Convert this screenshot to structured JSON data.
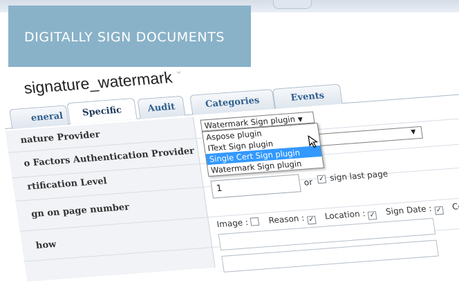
{
  "banner": {
    "title": "DIGITALLY SIGN DOCUMENTS"
  },
  "header": {
    "object_name": "signature_watermark"
  },
  "tabs": {
    "row1": [
      "eneral",
      "Specific",
      "Audit"
    ],
    "row2": [
      "Categories",
      "Events"
    ],
    "active": "Specific"
  },
  "fields": {
    "provider_label": "nature Provider",
    "two_factor_label": "o Factors Authentication Provider",
    "cert_level_label": "rtification Level",
    "page_number_label": "gn on page number",
    "show_label": "how"
  },
  "provider_select": {
    "selected": "Watermark Sign plugin",
    "options": [
      "Aspose plugin",
      "IText Sign plugin",
      "Single Cert Sign plugin",
      "Watermark Sign plugin"
    ],
    "highlighted": "Single Cert Sign plugin"
  },
  "page_number": {
    "value": "1",
    "or_text": "or",
    "sign_last_page_label": "sign last page",
    "sign_last_page_checked": true
  },
  "show": {
    "image_label": "Image :",
    "image_checked": false,
    "reason_label": "Reason :",
    "reason_checked": true,
    "location_label": "Location :",
    "location_checked": true,
    "sign_date_label": "Sign Date :",
    "sign_date_checked": true,
    "truncated_label": "Co"
  },
  "icons": {
    "caret": "caret-down-icon",
    "check": "checkmark-icon",
    "cursor": "pointer-cursor-icon"
  },
  "colors": {
    "banner": "#89b2c8",
    "highlight": "#3399ff",
    "tab_text": "#2f5f8f"
  }
}
